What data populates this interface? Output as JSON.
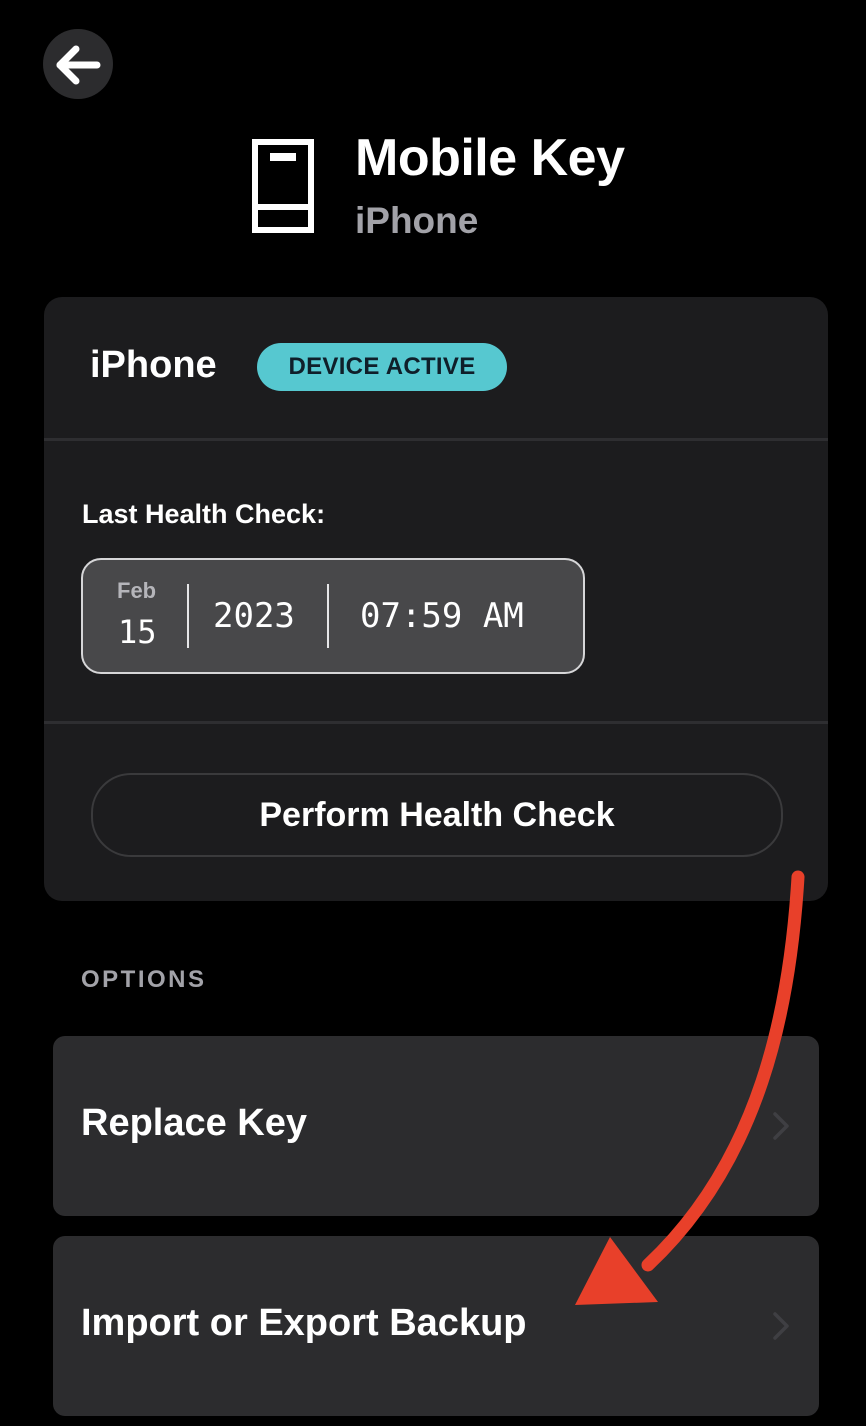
{
  "header": {
    "back_icon": "arrow-left-icon",
    "device_icon": "mobile-phone-icon",
    "title": "Mobile Key",
    "subtitle": "iPhone"
  },
  "device_card": {
    "device_name": "iPhone",
    "status_badge": "DEVICE ACTIVE",
    "status_color": "#56c8d0",
    "health_check_label": "Last Health Check:",
    "last_check": {
      "month": "Feb",
      "day": "15",
      "year": "2023",
      "time": "07:59 AM"
    },
    "perform_button": "Perform Health Check"
  },
  "options": {
    "section_label": "OPTIONS",
    "items": [
      {
        "label": "Replace Key",
        "icon": "chevron-right-icon"
      },
      {
        "label": "Import or Export Backup",
        "icon": "chevron-right-icon"
      }
    ]
  },
  "annotation": {
    "icon": "red-curved-arrow-icon",
    "color": "#e8402a"
  }
}
